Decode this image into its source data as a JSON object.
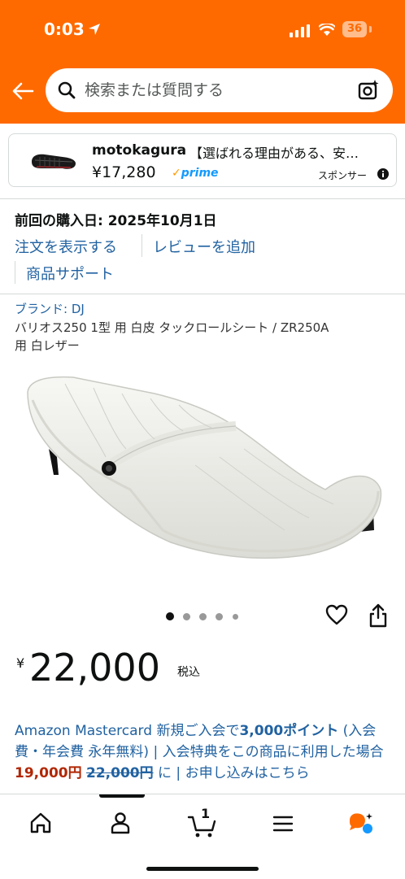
{
  "status_bar": {
    "time": "0:03",
    "battery": "36"
  },
  "search": {
    "placeholder": "検索または質問する"
  },
  "sponsored": {
    "brand": "motokagura",
    "description": "【選ばれる理由がある、安…",
    "price": "¥17,280",
    "prime": "prime",
    "label": "スポンサー"
  },
  "purchase": {
    "last_purchase": "前回の購入日: 2025年10月1日",
    "view_order": "注文を表示する",
    "add_review": "レビューを追加",
    "product_support": "商品サポート"
  },
  "product": {
    "brand": "ブランド: DJ",
    "title": "バリオス250 1型 用 白皮 タックロールシート / ZR250A 用 白レザー",
    "image_count": 5,
    "current_image": 1,
    "price_symbol": "¥",
    "price": "22,000",
    "tax_label": "税込"
  },
  "promo": {
    "text1": "Amazon Mastercard 新規ご入会で",
    "points": "3,000ポイント",
    "text2": " (入会費・年会費 永年無料) | 入会特典をこの商品に利用した場合",
    "discount_price": "19,000円",
    "space": " ",
    "original_price": "22,000円",
    "text3": " に | お申し込みはこちら"
  },
  "bottom_nav": {
    "items": [
      "home-icon",
      "account-icon",
      "cart-icon",
      "menu-icon",
      "rufus-icon"
    ],
    "cart_count": "1"
  },
  "colors": {
    "header": "#ff6a00",
    "link": "#2162a1",
    "deal_red": "#b12704",
    "prime_blue": "#1399ff"
  }
}
